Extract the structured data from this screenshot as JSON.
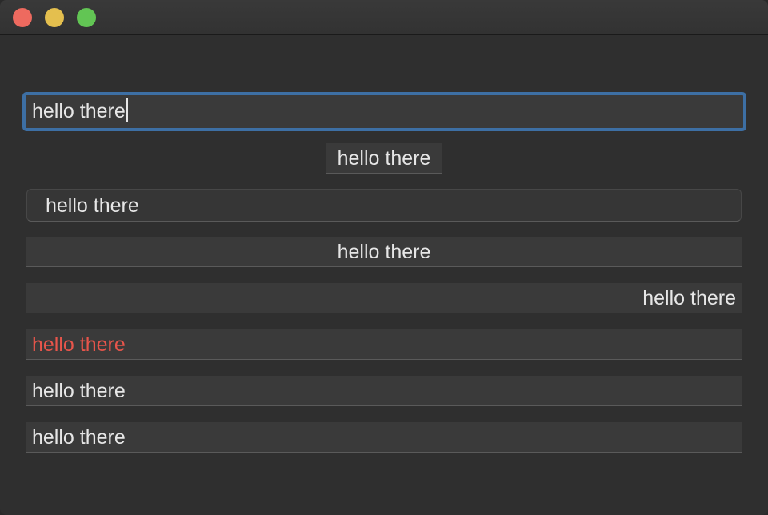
{
  "window": {
    "controls": {
      "close_color": "#ee6a5f",
      "minimize_color": "#e4bf4e",
      "maximize_color": "#62c554"
    }
  },
  "fields": {
    "focused": {
      "value": "hello there"
    },
    "autosize": {
      "value": "hello there"
    },
    "rounded": {
      "value": "hello there"
    },
    "centered": {
      "value": "hello there"
    },
    "right_aligned": {
      "value": "hello there"
    },
    "colored": {
      "value": "hello there",
      "color": "#e8554b"
    },
    "plain_1": {
      "value": "hello there"
    },
    "plain_2": {
      "value": "hello there"
    }
  },
  "colors": {
    "focus_ring": "#3d6fa4",
    "text": "#e6e6e6",
    "field_bg": "#3a3a3a",
    "window_bg": "#2f2f2f"
  }
}
